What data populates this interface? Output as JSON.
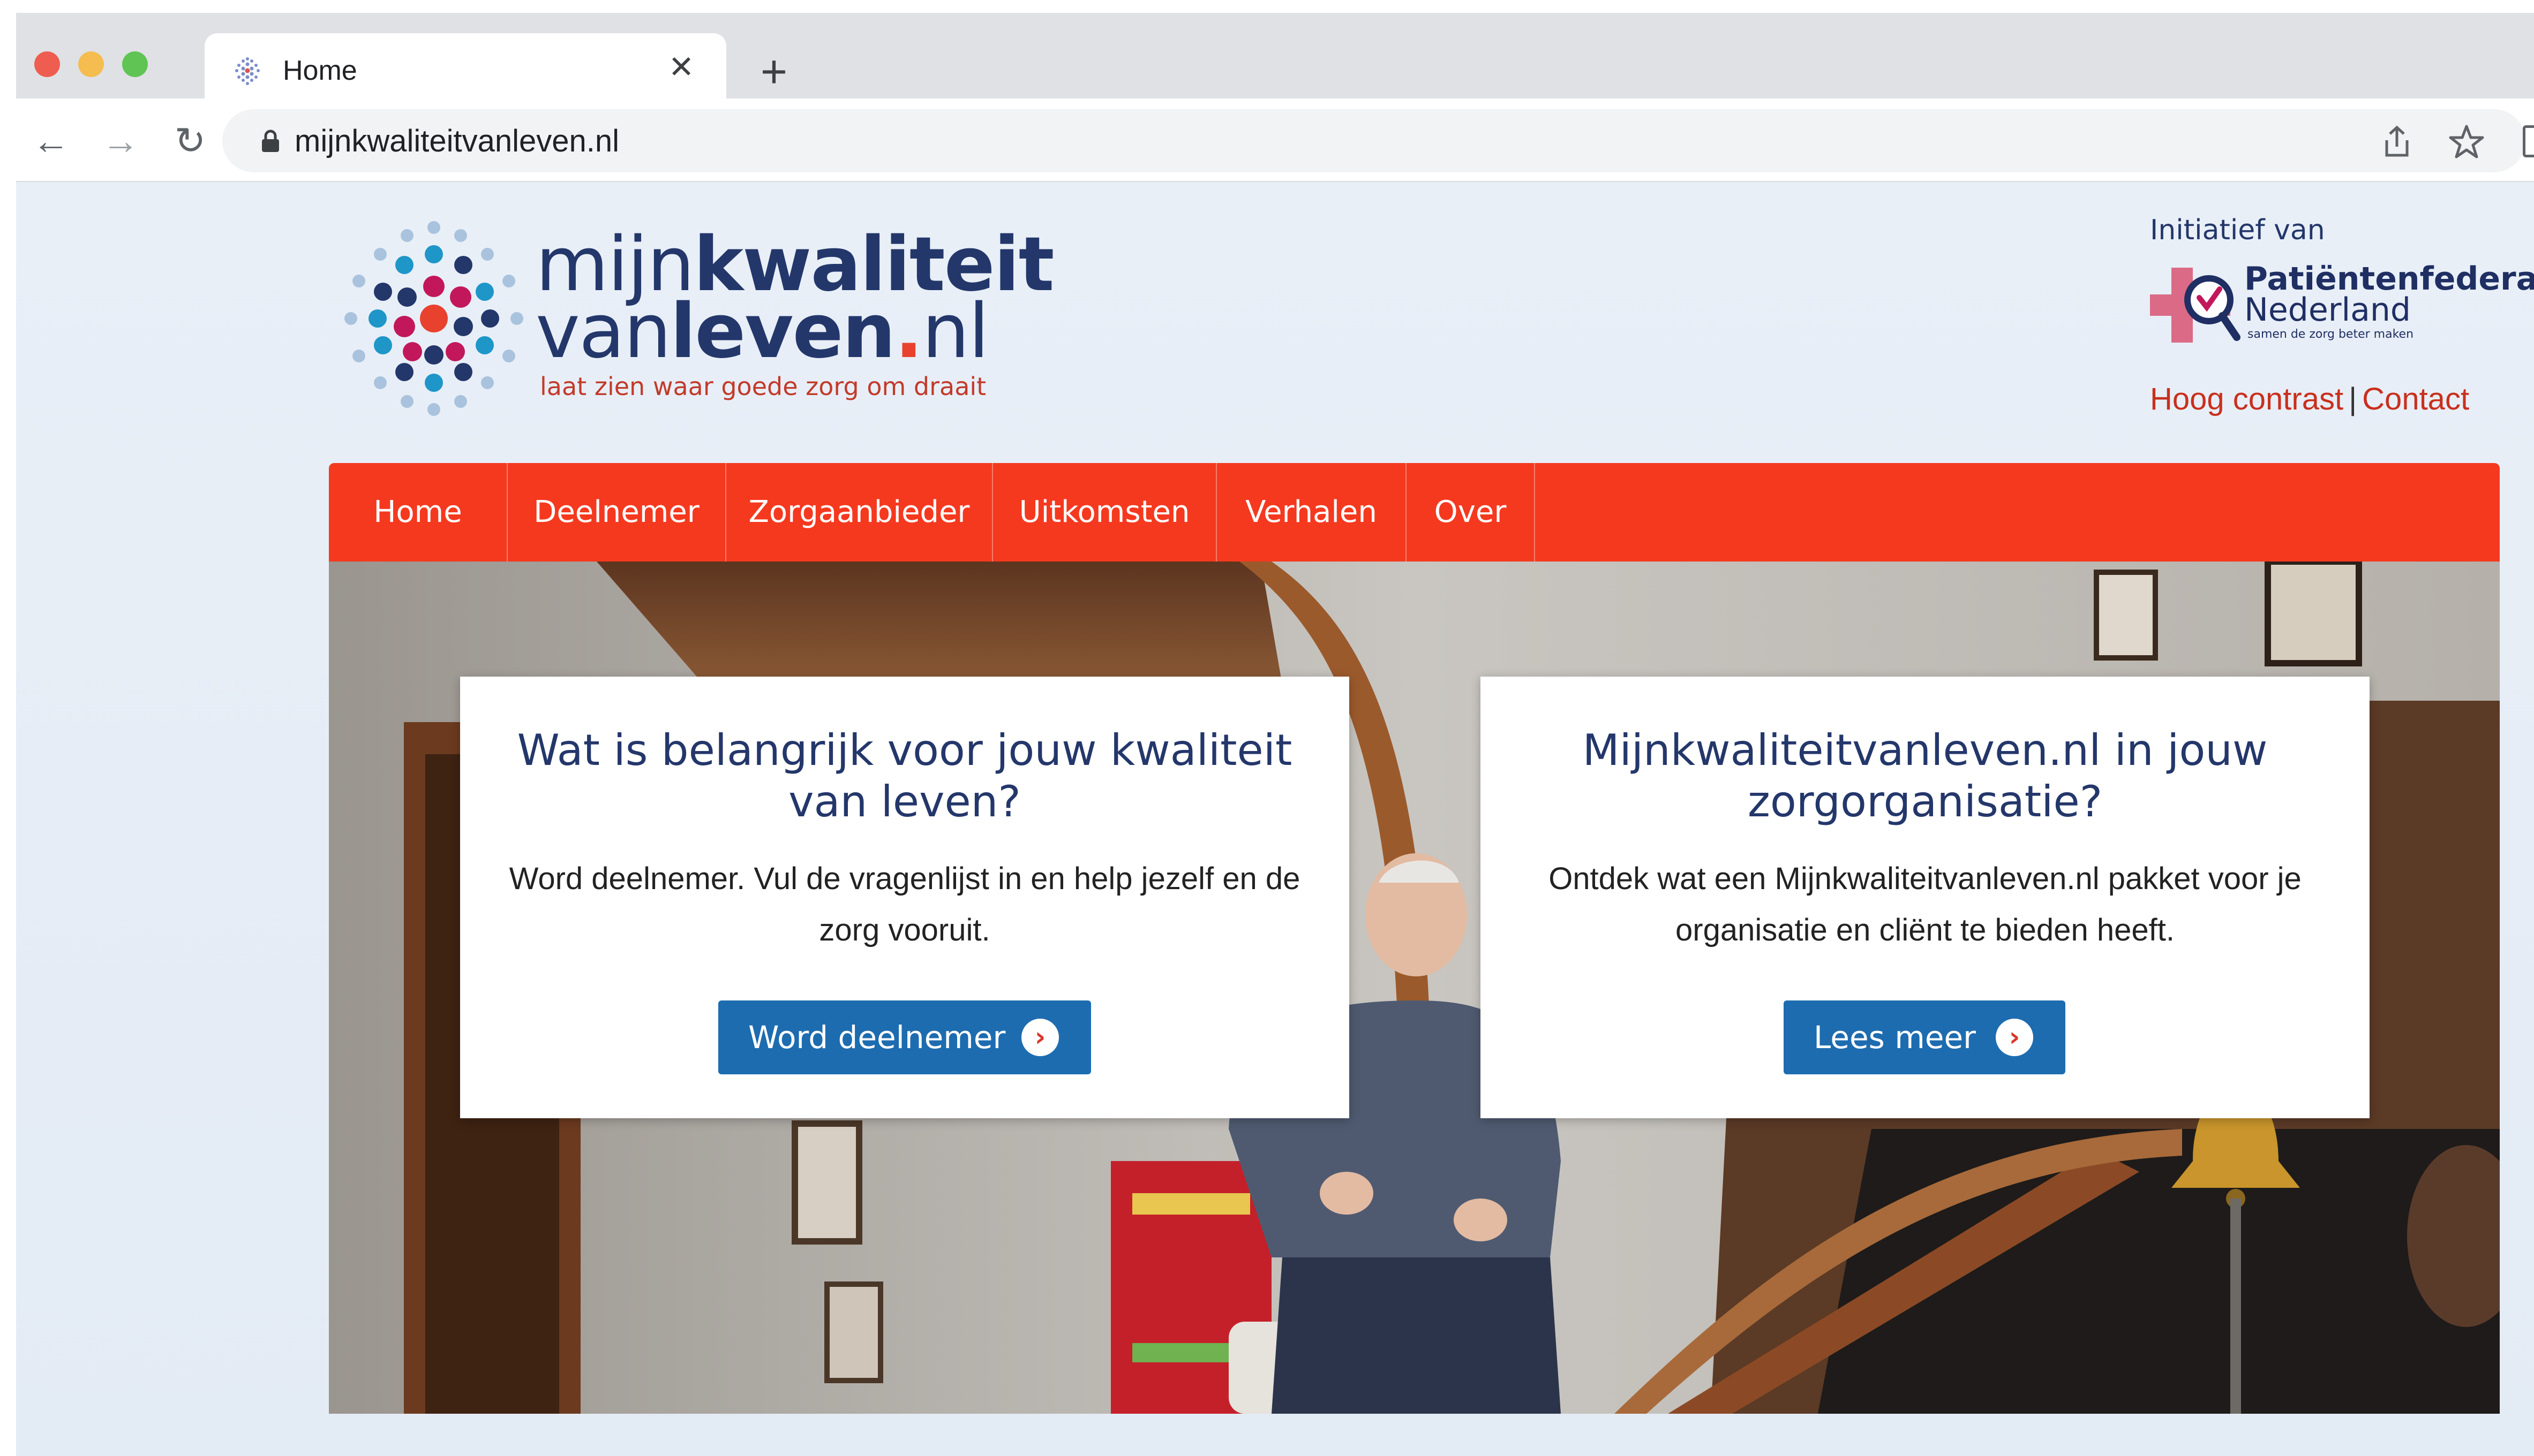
{
  "browser": {
    "tab_title": "Home",
    "tab_close": "✕",
    "new_tab": "+",
    "url": "mijnkwaliteitvanleven.nl",
    "nav": {
      "back": "←",
      "forward": "→",
      "reload": "↻"
    },
    "icons": {
      "share": "share-icon",
      "bookmark": "star-icon"
    }
  },
  "header": {
    "logo": {
      "line1_light": "mijn",
      "line1_bold": "kwaliteit",
      "line2_light": "van",
      "line2_bold": "leven",
      "line2_dot": ".",
      "line2_tld": "nl",
      "tagline": "laat zien waar goede zorg om draait"
    },
    "initiative_label": "Initiatief van",
    "partner": {
      "name_line1": "Patiëntenfederatie",
      "name_line2": "Nederland",
      "tagline": "samen de zorg beter maken"
    },
    "utility_links": {
      "contrast": "Hoog contrast",
      "separator": "|",
      "contact": "Contact"
    }
  },
  "nav": {
    "items": [
      {
        "label": "Home"
      },
      {
        "label": "Deelnemer"
      },
      {
        "label": "Zorgaanbieder"
      },
      {
        "label": "Uitkomsten"
      },
      {
        "label": "Verhalen"
      },
      {
        "label": "Over"
      }
    ]
  },
  "hero": {
    "cards": [
      {
        "title": "Wat is belangrijk voor jouw kwaliteit van leven?",
        "body": "Word deelnemer. Vul de vragenlijst in en help jezelf en de zorg vooruit.",
        "button": "Word deelnemer"
      },
      {
        "title": "Mijnkwaliteitvanleven.nl in jouw zorgorganisatie?",
        "body": "Ontdek wat een Mijnkwaliteitvanleven.nl pakket voor je organisatie en cliënt te bieden heeft.",
        "button": "Lees meer"
      }
    ]
  },
  "colors": {
    "brand_orange": "#f5391f",
    "brand_navy": "#24376b",
    "button_blue": "#1d6cb0",
    "link_red": "#c8301e"
  }
}
